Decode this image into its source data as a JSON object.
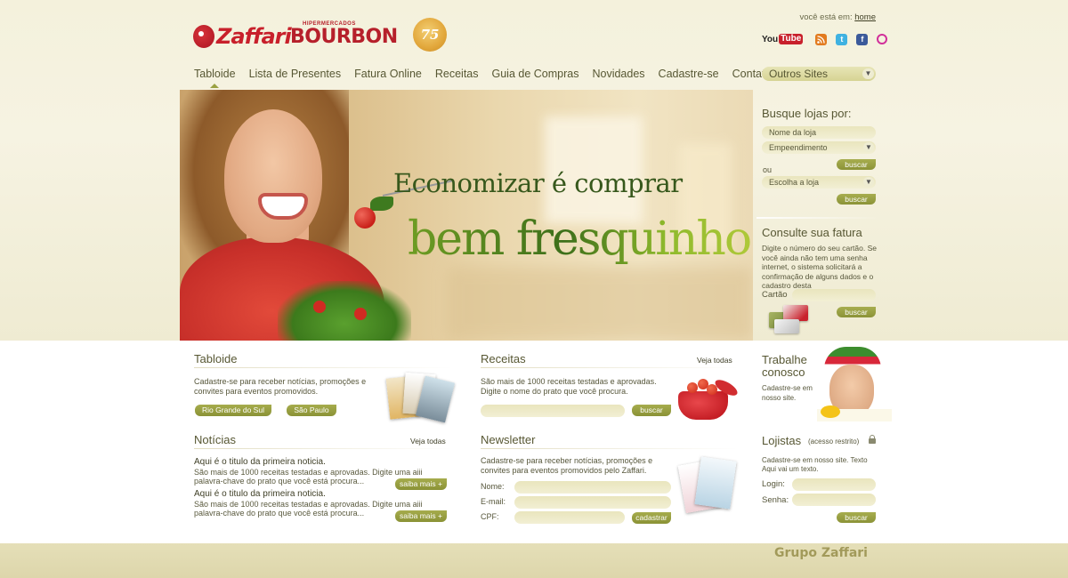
{
  "header": {
    "brand_zaffari": "Zaffari",
    "brand_bourbon_sub": "HIPERMERCADOS",
    "brand_bourbon": "BOURBON",
    "anniversary": "75",
    "breadcrumb_prefix": "você está em:",
    "breadcrumb_link": "home",
    "social": {
      "youtube_you": "You",
      "youtube_tube": "Tube",
      "icons": [
        "rss-icon",
        "twitter-icon",
        "facebook-icon",
        "orkut-icon"
      ]
    }
  },
  "nav": {
    "items": [
      {
        "label": "Tabloide",
        "active": true
      },
      {
        "label": "Lista de Presentes"
      },
      {
        "label": "Fatura Online"
      },
      {
        "label": "Receitas"
      },
      {
        "label": "Guia de Compras"
      },
      {
        "label": "Novidades"
      },
      {
        "label": "Cadastre-se"
      },
      {
        "label": "Contato"
      }
    ],
    "other_sites": "Outros Sites"
  },
  "hero": {
    "line1": "Economizar é comprar",
    "line2": "bem fresquinho"
  },
  "store_search": {
    "title": "Busque lojas por:",
    "name_placeholder": "Nome da loja",
    "empreendimento": "Empeendimento",
    "buscar1": "buscar",
    "or": "ou",
    "escolha": "Escolha a loja",
    "buscar2": "buscar"
  },
  "invoice": {
    "title": "Consulte sua fatura",
    "text": "Digite o número do seu cartão. Se você ainda não tem uma senha internet, o sistema solicitará a confirmação de alguns dados e o cadastro desta",
    "card_label": "Cartão",
    "buscar": "buscar"
  },
  "tabloide": {
    "title": "Tabloide",
    "text": "Cadastre-se para receber notícias, promoções e convites para eventos promovidos.",
    "btn_rs": "Rio Grande do Sul",
    "btn_sp": "São Paulo"
  },
  "receitas": {
    "title": "Receitas",
    "see_all": "Veja todas",
    "text": "São mais de 1000 receitas testadas e aprovadas. Digite o nome do prato que você procura.",
    "buscar": "buscar"
  },
  "trabalhe": {
    "title1": "Trabalhe",
    "title2": "conosco",
    "text": "Cadastre-se em nosso site."
  },
  "noticias": {
    "title": "Notícias",
    "see_all": "Veja todas",
    "items": [
      {
        "title": "Aqui é o titulo da primeira noticia.",
        "text": "São mais de 1000 receitas testadas e aprovadas. Digite uma aiii palavra-chave do prato que você está procura...",
        "more": "saiba mais +"
      },
      {
        "title": "Aqui é o titulo da primeira noticia.",
        "text": "São mais de 1000 receitas testadas e aprovadas. Digite uma aiii palavra-chave do prato que você está procura...",
        "more": "saiba mais +"
      }
    ]
  },
  "newsletter": {
    "title": "Newsletter",
    "text": "Cadastre-se para receber notícias, promoções e convites para eventos promovidos pelo Zaffari.",
    "name_label": "Nome:",
    "email_label": "E-mail:",
    "cpf_label": "CPF:",
    "submit": "cadastrar"
  },
  "lojistas": {
    "title": "Lojistas",
    "restricted": "(acesso restrito)",
    "text": "Cadastre-se em nosso site. Texto Aqui vai um texto.",
    "login_label": "Login:",
    "password_label": "Senha:",
    "buscar": "buscar"
  },
  "footer": {
    "brand": "Grupo Zaffari"
  },
  "colors": {
    "accent_green": "#9aa142",
    "brand_red": "#c8202b",
    "text_olive": "#575733",
    "footer_bg": "#e0d9b0"
  }
}
